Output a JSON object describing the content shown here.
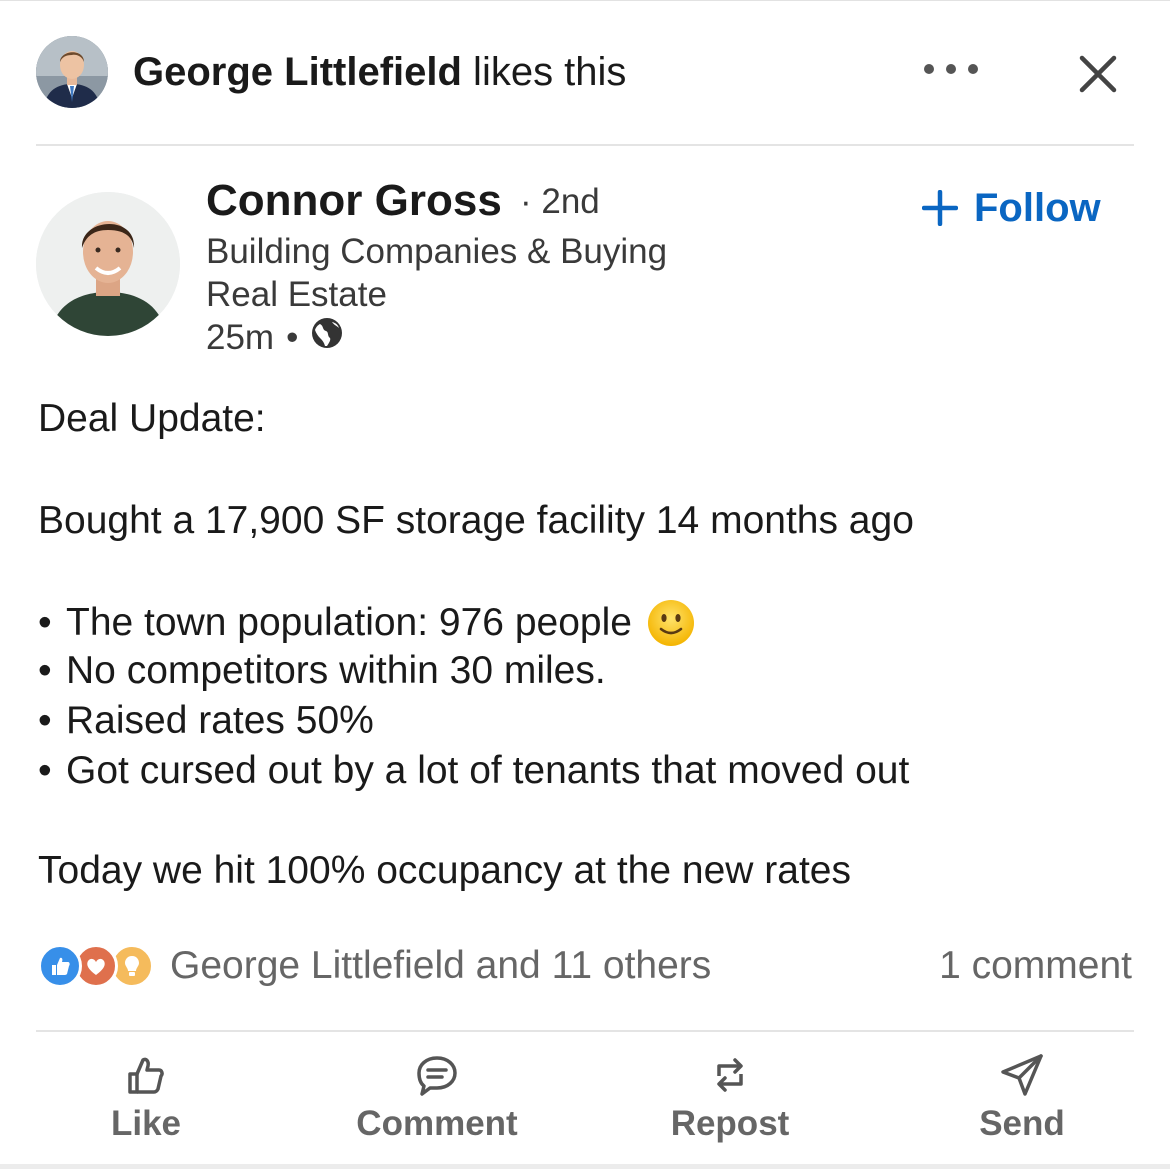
{
  "social_context": {
    "name": "George Littlefield",
    "action": " likes this"
  },
  "author": {
    "name": "Connor Gross",
    "degree": "· 2nd",
    "headline": "Building Companies & Buying Real Estate",
    "time": "25m",
    "time_sep": "•",
    "visibility_icon": "globe-icon"
  },
  "follow": {
    "label": "Follow",
    "color": "#0a66c2"
  },
  "post": {
    "heading": "Deal Update:",
    "intro": "Bought a 17,900 SF storage facility 14 months ago",
    "bullets": [
      "The town population: 976 people",
      "No competitors within 30 miles.",
      "Raised rates 50%",
      "Got cursed out by a lot of tenants that moved out"
    ],
    "bullet_symbol": "•",
    "closing": "Today we hit 100% occupancy at the new rates"
  },
  "reactions": {
    "icons": [
      "like-reaction-icon",
      "love-reaction-icon",
      "insightful-reaction-icon"
    ],
    "text": "George Littlefield and 11 others",
    "comments": "1 comment"
  },
  "actions": {
    "like": "Like",
    "comment": "Comment",
    "repost": "Repost",
    "send": "Send"
  }
}
